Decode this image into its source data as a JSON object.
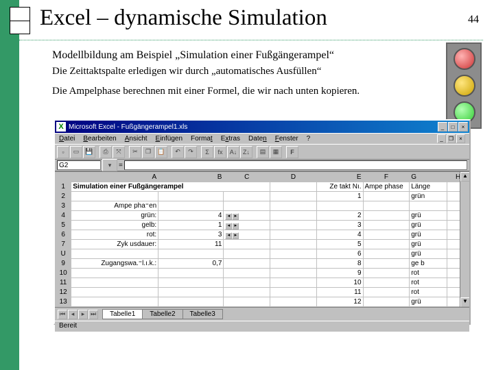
{
  "title": "Excel – dynamische Simulation",
  "page_number": "44",
  "subtitle": "Modellbildung am Beispiel „Simulation einer Fußgängerampel“",
  "paragraph1": "Die Zeittaktspalte erledigen wir durch „automatisches Ausfüllen“",
  "paragraph2": "Die Ampelphase berechnen mit einer Formel, die wir nach unten kopieren.",
  "excel": {
    "app_title": "Microsoft Excel - Fußgängerampel1.xls",
    "menu": {
      "datei": "Datei",
      "bearbeiten": "Bearbeiten",
      "ansicht": "Ansicht",
      "einfuegen": "Einfügen",
      "format": "Format",
      "extras": "Extras",
      "daten": "Daten",
      "fenster": "Fenster",
      "help": "?"
    },
    "namebox_value": "G2",
    "formula_value": "=",
    "columns": [
      "A",
      "B",
      "C",
      "D",
      "E",
      "F",
      "G",
      "H"
    ],
    "rowheaders": [
      "1",
      "2",
      "3",
      "4",
      "5",
      "6",
      "7",
      "U",
      "9",
      "10",
      "11",
      "12",
      "13"
    ],
    "cells": {
      "A1": "Simulation einer Fußgängerampel",
      "E1": "Ze takt Nı.",
      "F1": "Ampe phase",
      "G1": "Länge",
      "A3": "Ampe pha⁼en",
      "E2": "1",
      "G2": "grün",
      "A4": "grün:",
      "B4": "4",
      "E4": "2",
      "G4": "grü",
      "A5": "gelb:",
      "B5": "1",
      "E5": "3",
      "G5": "grü",
      "A6": "rot:",
      "B6": "3",
      "E6": "4",
      "G6": "grü",
      "A7": "Zyk usdauer:",
      "B7": "11",
      "E7": "5",
      "G7": "grü",
      "E8": "6",
      "G8": "grü",
      "A9": "Zugangswa.⁼l.ı.k.:",
      "B9": "0,7",
      "E9": "8",
      "G9": "ge b",
      "E10": "9",
      "G10": "rot",
      "E11": "10",
      "G11": "rot",
      "E12": "11",
      "G12": "rot",
      "E13": "12",
      "G13": "grü"
    },
    "tabs": [
      "Tabelle1",
      "Tabelle2",
      "Tabelle3"
    ],
    "status": "Bereit"
  }
}
